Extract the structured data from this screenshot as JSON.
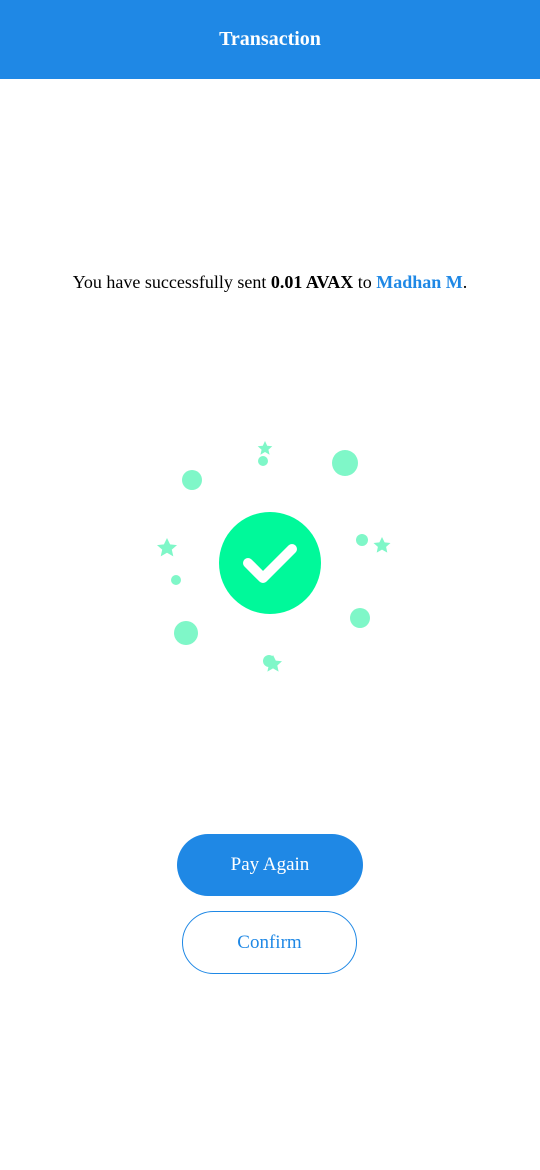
{
  "header": {
    "title": "Transaction"
  },
  "message": {
    "prefix": "You have successfully sent ",
    "amount": "0.01 AVAX",
    "middle": " to ",
    "recipient": "Madhan M",
    "suffix": "."
  },
  "illustration": {
    "icon": "check-circle-icon",
    "accent_color": "#00f99a",
    "confetti_color": "#7ff7c8"
  },
  "actions": {
    "pay_again_label": "Pay Again",
    "confirm_label": "Confirm"
  },
  "colors": {
    "brand": "#1f88e5",
    "background": "#ffffff"
  }
}
